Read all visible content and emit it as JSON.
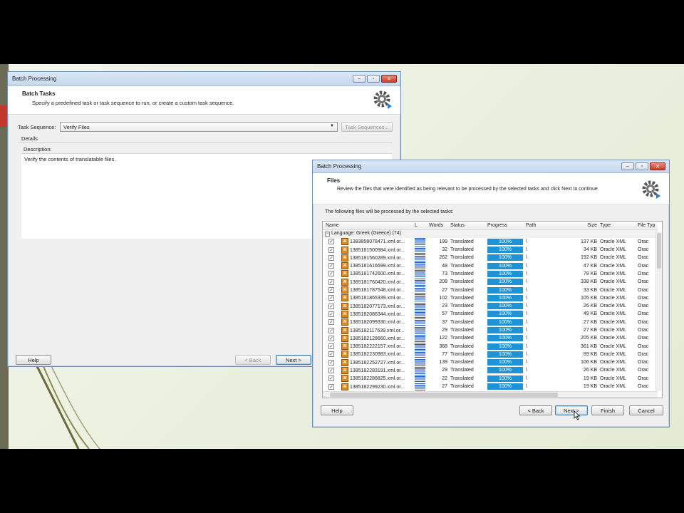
{
  "colors": {
    "progress": "#1e94d6",
    "accent": "#c0392b",
    "titlebar": "#c6d8ef"
  },
  "win1": {
    "title": "Batch Processing",
    "header_title": "Batch Tasks",
    "header_subtitle": "Specify a predefined task or task sequence to run, or create a custom task sequence.",
    "task_sequence_label": "Task Sequence:",
    "task_sequence_value": "Verify Files",
    "task_sequences_button": "Task Sequences...",
    "details_label": "Details",
    "description_label": "Description:",
    "description_text": "Verify the contents of translatable files.",
    "help_button": "Help",
    "back_button": "< Back",
    "next_button": "Next >"
  },
  "win2": {
    "title": "Batch Processing",
    "header_title": "Files",
    "header_subtitle": "Review the files that were identified as being relevant to be processed by the selected tasks and click Next to continue.",
    "intro_text": "The following files will be processed by the selected tasks:",
    "columns": [
      "Name",
      "L",
      "Words",
      "Status",
      "Progress",
      "Path",
      "Size",
      "Type",
      "File Typ"
    ],
    "group_label": "Language: Greek (Greece) (74)",
    "rows": [
      {
        "name": "1383858078471.xml.or...",
        "words": "199",
        "status": "Translated",
        "progress": "100%",
        "path": "\\",
        "size": "137 KB",
        "type": "Oracle XML",
        "filetype": "Orac"
      },
      {
        "name": "1385181500984.xml.or...",
        "words": "32",
        "status": "Translated",
        "progress": "100%",
        "path": "\\",
        "size": "34 KB",
        "type": "Oracle XML",
        "filetype": "Orac"
      },
      {
        "name": "1385181560289.xml.or...",
        "words": "262",
        "status": "Translated",
        "progress": "100%",
        "path": "\\",
        "size": "192 KB",
        "type": "Oracle XML",
        "filetype": "Orac"
      },
      {
        "name": "1385181616699.xml.or...",
        "words": "48",
        "status": "Translated",
        "progress": "100%",
        "path": "\\",
        "size": "47 KB",
        "type": "Oracle XML",
        "filetype": "Orac"
      },
      {
        "name": "1385181742600.xml.or...",
        "words": "73",
        "status": "Translated",
        "progress": "100%",
        "path": "\\",
        "size": "78 KB",
        "type": "Oracle XML",
        "filetype": "Orac"
      },
      {
        "name": "1385181760420.xml.or...",
        "words": "208",
        "status": "Translated",
        "progress": "100%",
        "path": "\\",
        "size": "338 KB",
        "type": "Oracle XML",
        "filetype": "Orac"
      },
      {
        "name": "1385181787548.xml.or...",
        "words": "27",
        "status": "Translated",
        "progress": "100%",
        "path": "\\",
        "size": "33 KB",
        "type": "Oracle XML",
        "filetype": "Orac"
      },
      {
        "name": "1385181865339.xml.or...",
        "words": "102",
        "status": "Translated",
        "progress": "100%",
        "path": "\\",
        "size": "105 KB",
        "type": "Oracle XML",
        "filetype": "Orac"
      },
      {
        "name": "1385182077173.xml.or...",
        "words": "23",
        "status": "Translated",
        "progress": "100%",
        "path": "\\",
        "size": "26 KB",
        "type": "Oracle XML",
        "filetype": "Orac"
      },
      {
        "name": "1385182086344.xml.or...",
        "words": "57",
        "status": "Translated",
        "progress": "100%",
        "path": "\\",
        "size": "49 KB",
        "type": "Oracle XML",
        "filetype": "Orac"
      },
      {
        "name": "1385182099330.xml.or...",
        "words": "37",
        "status": "Translated",
        "progress": "100%",
        "path": "\\",
        "size": "27 KB",
        "type": "Oracle XML",
        "filetype": "Orac"
      },
      {
        "name": "1385182117639.xml.or...",
        "words": "29",
        "status": "Translated",
        "progress": "100%",
        "path": "\\",
        "size": "27 KB",
        "type": "Oracle XML",
        "filetype": "Orac"
      },
      {
        "name": "1385182128660.xml.or...",
        "words": "122",
        "status": "Translated",
        "progress": "100%",
        "path": "\\",
        "size": "205 KB",
        "type": "Oracle XML",
        "filetype": "Orac"
      },
      {
        "name": "1385182222157.xml.or...",
        "words": "368",
        "status": "Translated",
        "progress": "100%",
        "path": "\\",
        "size": "361 KB",
        "type": "Oracle XML",
        "filetype": "Orac"
      },
      {
        "name": "1385182230983.xml.or...",
        "words": "77",
        "status": "Translated",
        "progress": "100%",
        "path": "\\",
        "size": "89 KB",
        "type": "Oracle XML",
        "filetype": "Orac"
      },
      {
        "name": "1385182252727.xml.or...",
        "words": "139",
        "status": "Translated",
        "progress": "100%",
        "path": "\\",
        "size": "106 KB",
        "type": "Oracle XML",
        "filetype": "Orac"
      },
      {
        "name": "1385182283191.xml.or...",
        "words": "29",
        "status": "Translated",
        "progress": "100%",
        "path": "\\",
        "size": "26 KB",
        "type": "Oracle XML",
        "filetype": "Orac"
      },
      {
        "name": "1385182286825.xml.or...",
        "words": "22",
        "status": "Translated",
        "progress": "100%",
        "path": "\\",
        "size": "19 KB",
        "type": "Oracle XML",
        "filetype": "Orac"
      },
      {
        "name": "1385182299230.xml.or...",
        "words": "27",
        "status": "Translated",
        "progress": "100%",
        "path": "\\",
        "size": "19 KB",
        "type": "Oracle XML",
        "filetype": "Orac"
      }
    ],
    "help_button": "Help",
    "back_button": "< Back",
    "next_button": "Next >",
    "finish_button": "Finish",
    "cancel_button": "Cancel"
  }
}
